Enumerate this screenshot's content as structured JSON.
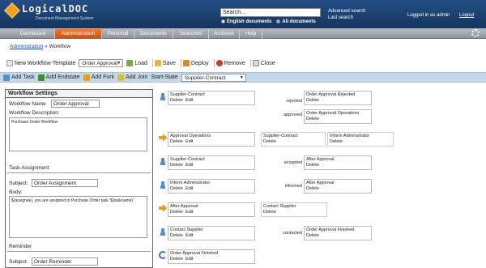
{
  "header": {
    "logo_text": "LogicalDOC",
    "logo_sub": "Document Management System",
    "search_placeholder": "Search...",
    "radio_english": "English documents",
    "radio_all": "All documents",
    "advanced_search": "Advanced search",
    "last_search": "Last search",
    "logged_in": "Logged in as admin",
    "logout": "Logout"
  },
  "nav": {
    "tabs": [
      {
        "label": "Dashboard"
      },
      {
        "label": "Administration"
      },
      {
        "label": "Personal"
      },
      {
        "label": "Documents"
      },
      {
        "label": "Searches"
      },
      {
        "label": "Archives"
      },
      {
        "label": "Help"
      }
    ],
    "active_color": "#e0601a"
  },
  "breadcrumb": {
    "link": "Administration",
    "sep": "»",
    "current": "Workflow"
  },
  "toolbar": {
    "new_template": "New Workflow-Template",
    "selected_workflow": "Order Approval",
    "load": "Load",
    "save": "Save",
    "deploy": "Deploy",
    "remove": "Remove",
    "close": "Close"
  },
  "toolbar2": {
    "add_task": "Add Task",
    "add_endstate": "Add Endstate",
    "add_fork": "Add Fork",
    "add_join": "Add Join",
    "start_state_label": "Start-State",
    "start_state_value": "Supplier-Contract"
  },
  "settings": {
    "title": "Workflow Settings",
    "name_label": "Workflow Name",
    "name_value": "Order Approval",
    "desc_label": "Workflow Description:",
    "desc_value": "Purchase Order Workflow",
    "task_assignment": "Task-Assignment",
    "subject_label": "Subject:",
    "subject_value": "Order Assignment",
    "body_label": "Body:",
    "body_value": "${assignee}, you are assigned to Purchase Order task '${taskname}'.",
    "reminder": "Reminder",
    "reminder_subject_value": "Order Reminder"
  },
  "diagram": {
    "delete": "Delete",
    "edit": "Edit",
    "rows": [
      {
        "node": "Supplier-Contract",
        "icon": "user-icon",
        "transitions": [
          {
            "label": "rejected",
            "target": "Order Approval Rejected"
          },
          {
            "label": "approved",
            "target": "Order Approval Operations"
          }
        ]
      },
      {
        "node": "Approval Operations",
        "icon": "fork-arrow-icon",
        "targets": [
          "Supplier-Contract",
          "Inform Administrator"
        ]
      },
      {
        "node": "Supplier-Contract",
        "icon": "user-icon",
        "transitions": [
          {
            "label": "accepted",
            "target": "After Approval"
          }
        ]
      },
      {
        "node": "Inform Administrator",
        "icon": "user-icon",
        "transitions": [
          {
            "label": "informed",
            "target": "After Approval"
          }
        ]
      },
      {
        "node": "After Approval",
        "icon": "join-arrow-icon",
        "targets": [
          "Contact Supplier"
        ]
      },
      {
        "node": "Contact Supplier",
        "icon": "user-icon",
        "transitions": [
          {
            "label": "contacted",
            "target": "Order Approval Finished"
          }
        ]
      },
      {
        "node": "Order Approval Finished",
        "icon": "end-icon"
      }
    ]
  }
}
